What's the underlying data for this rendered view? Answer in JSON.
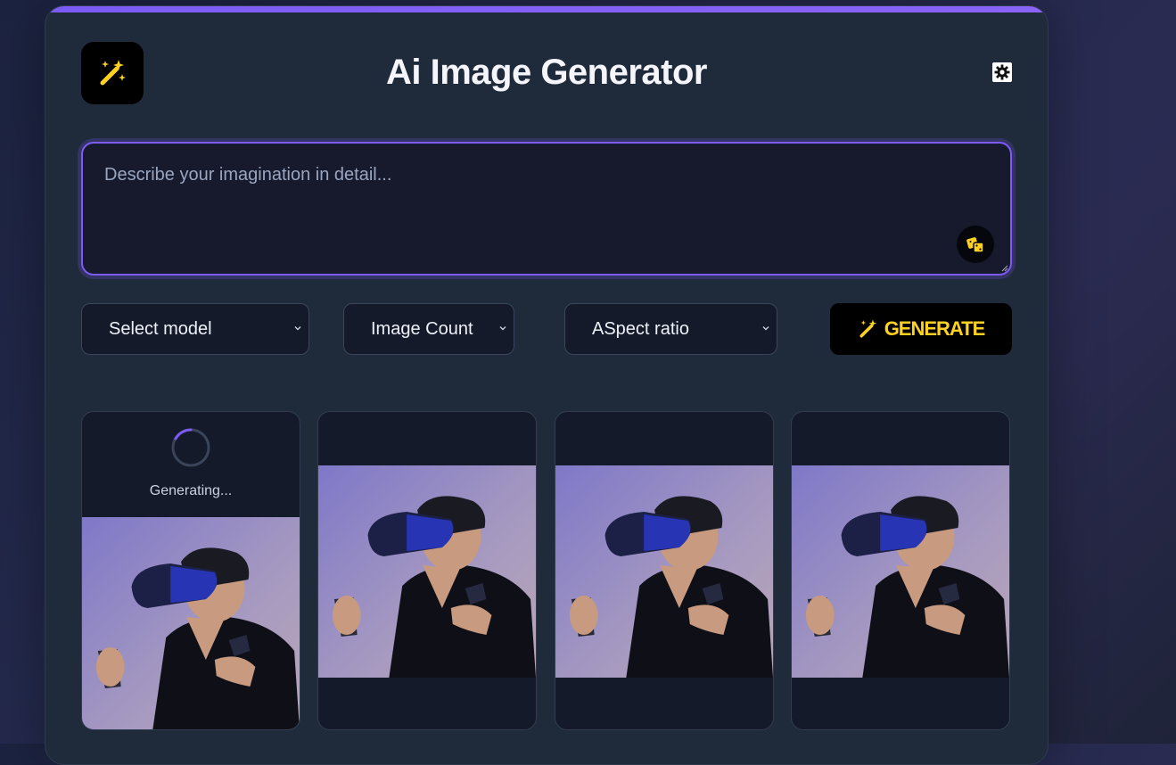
{
  "header": {
    "title": "Ai Image Generator",
    "logo_icon": "magic-wand-icon",
    "theme_icon": "gear-icon"
  },
  "prompt": {
    "placeholder": "Describe your imagination in detail...",
    "value": "",
    "random_icon": "dice-icon"
  },
  "controls": {
    "model_label": "Select model",
    "count_label": "Image Count",
    "ratio_label": "ASpect ratio",
    "generate_label": "GENERATE",
    "generate_icon": "magic-wand-icon"
  },
  "gallery": {
    "status_text": "Generating...",
    "cards": [
      {
        "state": "loading"
      },
      {
        "state": "done"
      },
      {
        "state": "done"
      },
      {
        "state": "done"
      }
    ]
  },
  "colors": {
    "accent": "#7c5cf5",
    "generate_text": "#ffd21f",
    "card_bg": "#1f2a3b"
  }
}
